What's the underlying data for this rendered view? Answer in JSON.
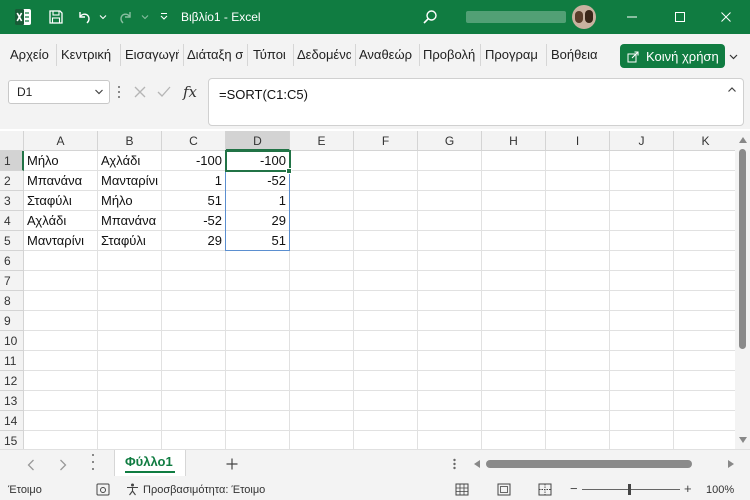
{
  "window": {
    "title": "Βιβλίο1 - Excel"
  },
  "menu": {
    "items": [
      "Αρχείο",
      "Κεντρική",
      "Εισαγωγή",
      "Διάταξη σ",
      "Τύποι",
      "Δεδομένα",
      "Αναθεώρ",
      "Προβολή",
      "Προγραμ",
      "Βοήθεια"
    ],
    "share_label": "Κοινή χρήση"
  },
  "formula_bar": {
    "name_box": "D1",
    "fx_label": "fx",
    "formula": "=SORT(C1:C5)"
  },
  "grid": {
    "columns": [
      "A",
      "B",
      "C",
      "D",
      "E",
      "F",
      "G",
      "H",
      "I",
      "J",
      "K"
    ],
    "rows": [
      "1",
      "2",
      "3",
      "4",
      "5",
      "6",
      "7",
      "8",
      "9",
      "10",
      "11",
      "12",
      "13",
      "14",
      "15"
    ],
    "data": [
      [
        "Μήλο",
        "Αχλάδι",
        "-100",
        "-100"
      ],
      [
        "Μπανάνα",
        "Μανταρίνι",
        "1",
        "-52"
      ],
      [
        "Σταφύλι",
        "Μήλο",
        "51",
        "1"
      ],
      [
        "Αχλάδι",
        "Μπανάνα",
        "-52",
        "29"
      ],
      [
        "Μανταρίνι",
        "Σταφύλι",
        "29",
        "51"
      ]
    ],
    "selected_cell": "D1"
  },
  "sheets": {
    "active": "Φύλλο1"
  },
  "status": {
    "ready": "Έτοιμο",
    "accessibility": "Προσβασιμότητα: Έτοιμο",
    "zoom": "100%"
  },
  "colors": {
    "brand": "#107c41",
    "selection": "#217346",
    "spill_border": "#5b8fd0"
  },
  "icons": [
    "excel-logo-icon",
    "save-icon",
    "undo-icon",
    "redo-icon",
    "customize-qat-icon",
    "search-icon",
    "avatar",
    "minimize-icon",
    "maximize-icon",
    "close-icon",
    "share-icon",
    "chevron-down-icon",
    "cancel-icon",
    "enter-icon",
    "function-icon",
    "expand-formula-icon",
    "scroll-left-icon",
    "scroll-right-icon",
    "add-sheet-icon",
    "more-icon",
    "cell-mode-icon",
    "accessibility-icon",
    "normal-view-icon",
    "page-layout-icon",
    "page-break-icon"
  ]
}
